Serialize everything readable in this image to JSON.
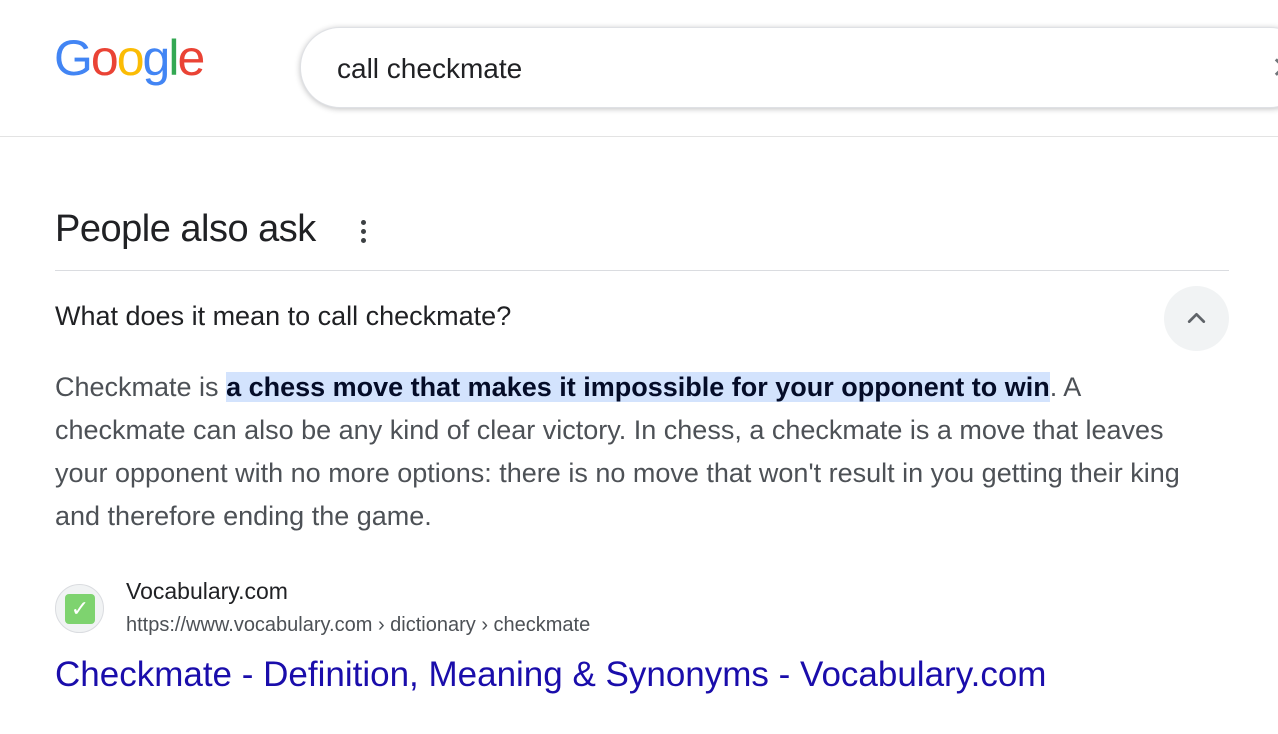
{
  "logo": {
    "letters": [
      "G",
      "o",
      "o",
      "g",
      "l",
      "e"
    ],
    "colors": [
      "#4285F4",
      "#EA4335",
      "#FBBC05",
      "#4285F4",
      "#34A853",
      "#EA4335"
    ]
  },
  "search": {
    "value": "call checkmate",
    "clear_icon": "close-icon"
  },
  "people_also_ask": {
    "title": "People also ask",
    "menu_icon": "more-vert-icon",
    "question": "What does it mean to call checkmate?",
    "expanded_icon": "chevron-up-icon",
    "answer": {
      "before": "Checkmate is ",
      "highlight": "a chess move that makes it impossible for your opponent to win",
      "after": ". A checkmate can also be any kind of clear victory. In chess, a checkmate is a move that leaves your opponent with no more options: there is no move that won't result in you getting their king and therefore ending the game."
    },
    "source": {
      "favicon": "checkmark-icon",
      "site_name": "Vocabulary.com",
      "url": "https://www.vocabulary.com › dictionary › checkmate",
      "link_title": "Checkmate - Definition, Meaning & Synonyms - Vocabulary.com"
    }
  },
  "colors": {
    "link": "#1a0dab",
    "highlight": "#d3e3fd"
  }
}
